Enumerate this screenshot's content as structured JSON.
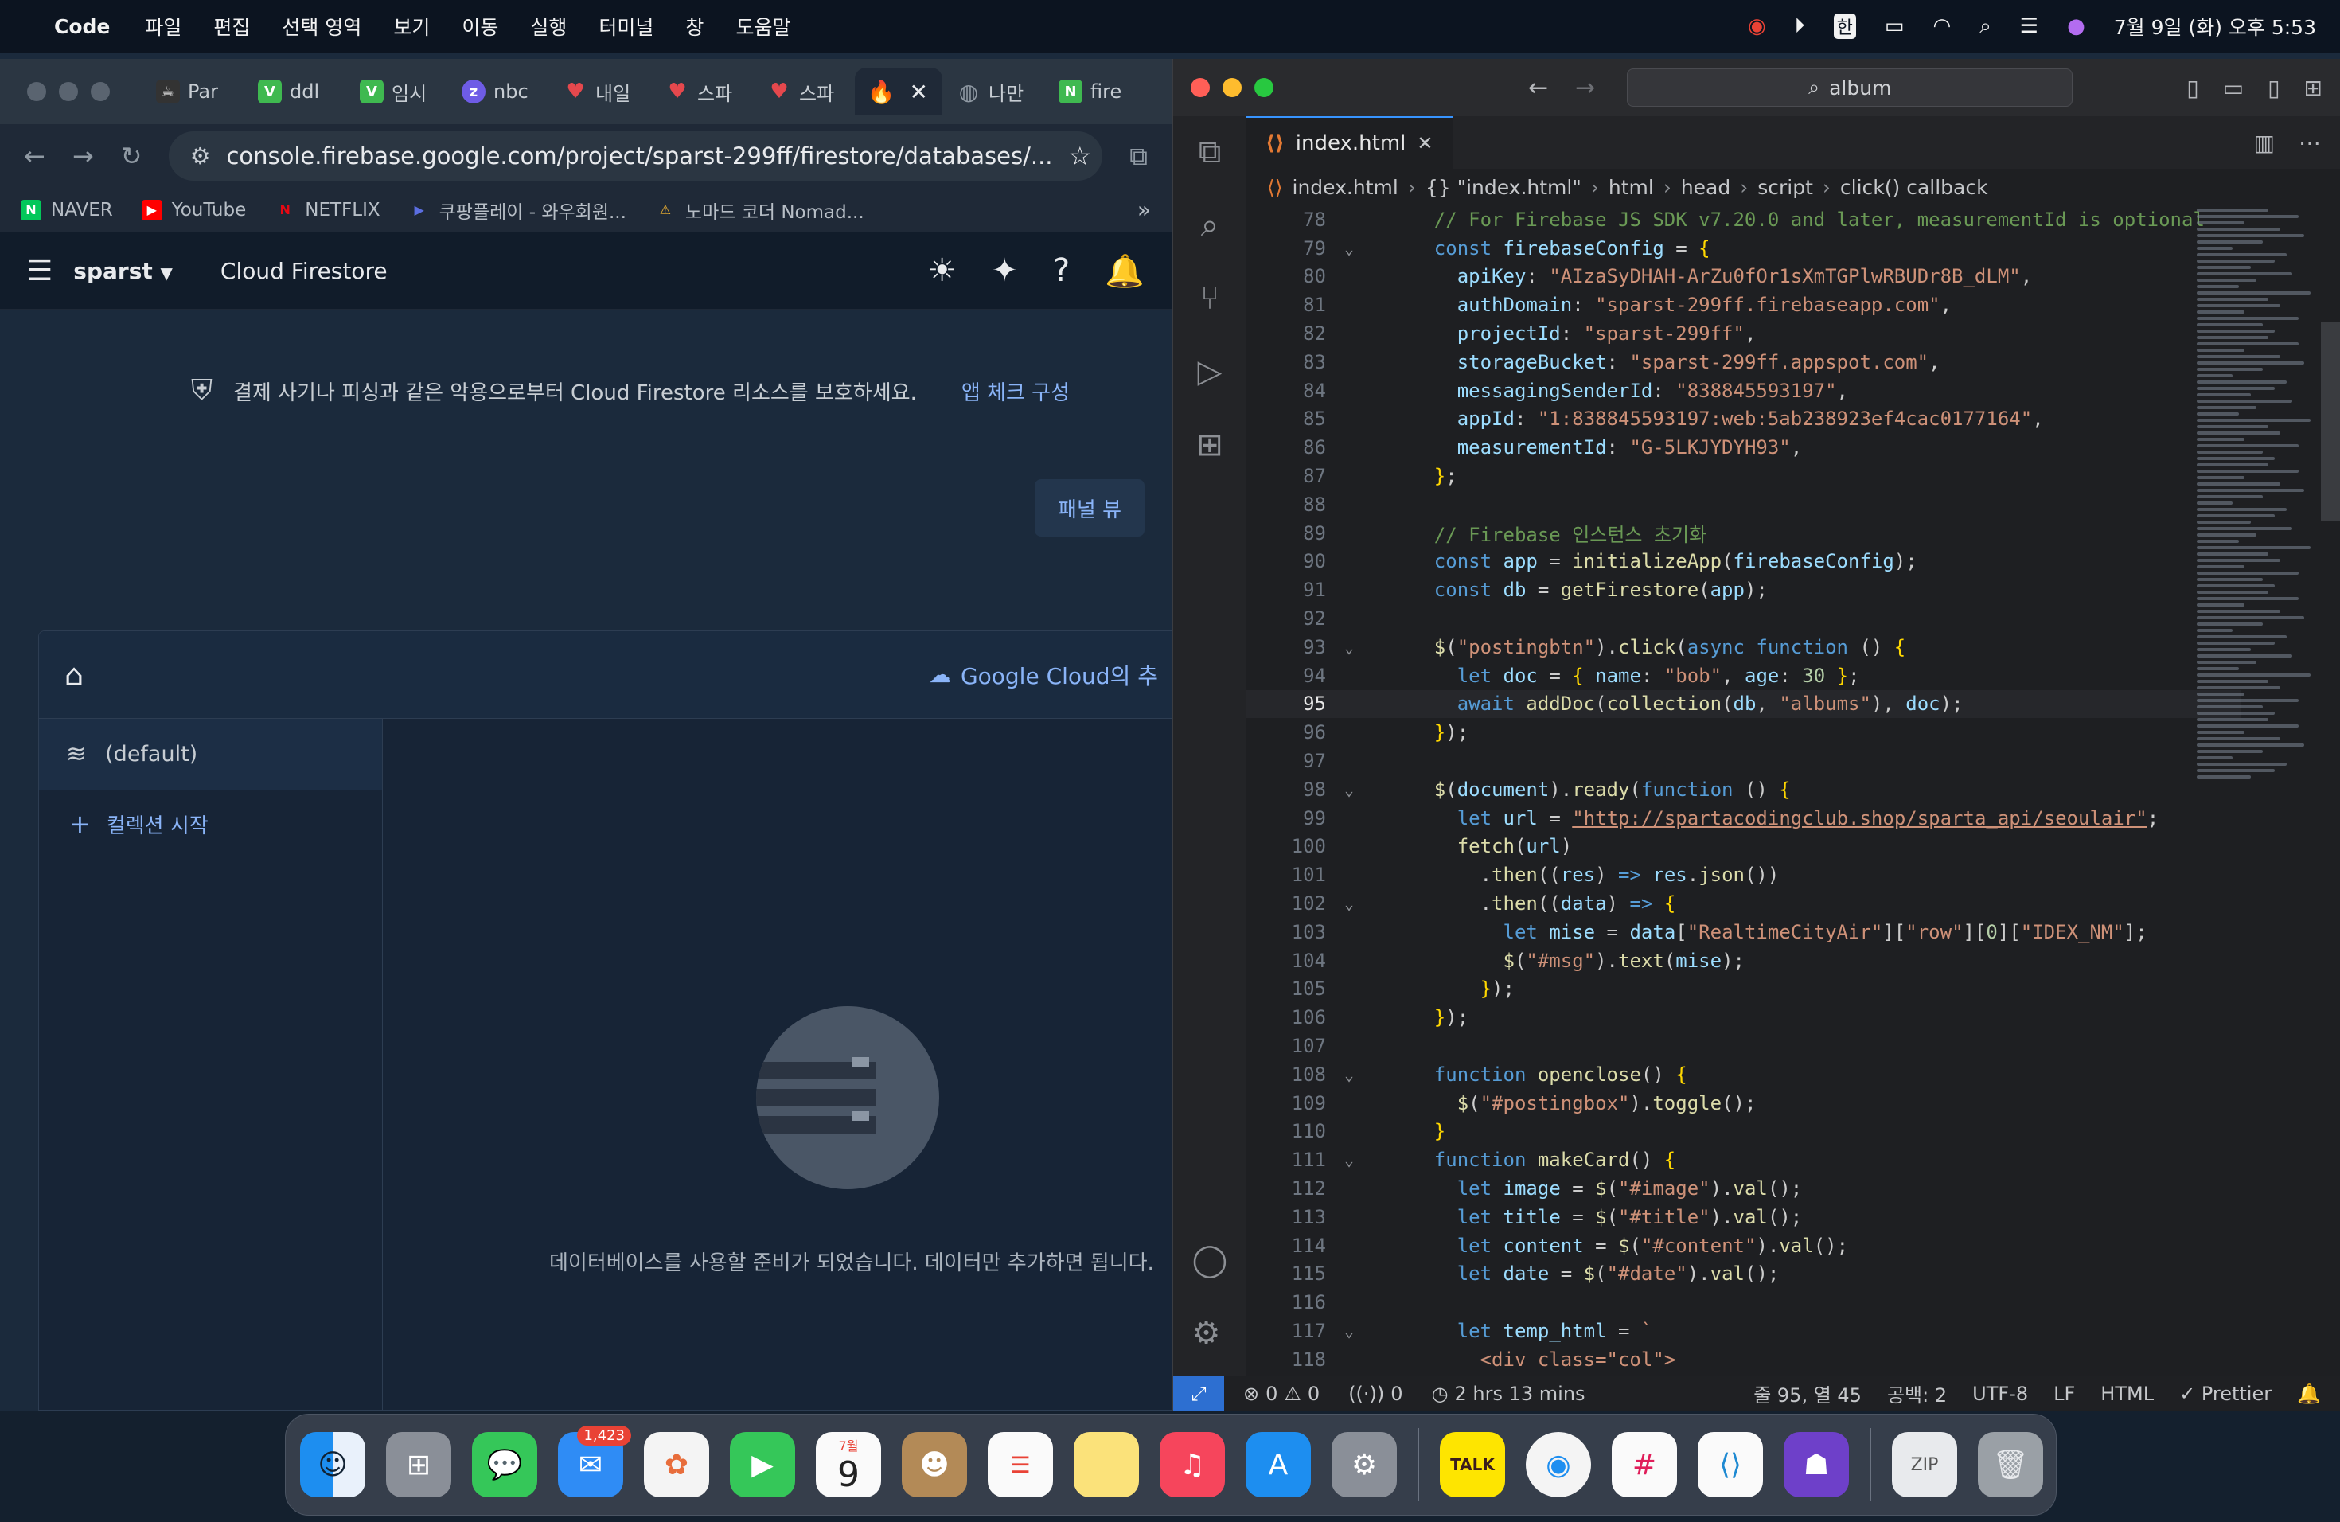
{
  "menubar": {
    "app_name": "Code",
    "items": [
      "파일",
      "편집",
      "선택 영역",
      "보기",
      "이동",
      "실행",
      "터미널",
      "창",
      "도움말"
    ],
    "datetime": "7월 9일 (화) 오후 5:53",
    "icons": [
      "screen-record-icon",
      "play-icon",
      "input-han-icon",
      "battery-icon",
      "wifi-icon",
      "search-icon",
      "control-center-icon",
      "siri-icon"
    ]
  },
  "chrome": {
    "tabs": [
      {
        "label": "Par",
        "icon": "coffee-icon",
        "color": "#333333"
      },
      {
        "label": "ddl",
        "icon": "v-icon",
        "color": "#3fb950"
      },
      {
        "label": "임시",
        "icon": "v-icon",
        "color": "#3fb950"
      },
      {
        "label": "nbc",
        "icon": "z-icon",
        "color": "#6e5ce6"
      },
      {
        "label": "내일",
        "icon": "heart-icon",
        "color": "#e5484d"
      },
      {
        "label": "스파",
        "icon": "heart-icon",
        "color": "#e5484d"
      },
      {
        "label": "스파",
        "icon": "heart-icon",
        "color": "#e5484d"
      },
      {
        "label": "",
        "icon": "firebase-icon",
        "color": "#f6a11a",
        "active": true
      },
      {
        "label": "나만",
        "icon": "globe-icon",
        "color": "#8f99a3"
      },
      {
        "label": "fire",
        "icon": "n-icon",
        "color": "#3fb950"
      }
    ],
    "url": "console.firebase.google.com/project/sparst-299ff/firestore/databases/...",
    "bookmarks": [
      {
        "label": "NAVER",
        "color": "#03c75a",
        "glyph": "N"
      },
      {
        "label": "YouTube",
        "color": "#ff0000",
        "glyph": "▶"
      },
      {
        "label": "NETFLIX",
        "color": "#e50914",
        "glyph": "N"
      },
      {
        "label": "쿠팡플레이 - 와우회원...",
        "color": "#5b6ee1",
        "glyph": "▶"
      },
      {
        "label": "노마드 코더 Nomad...",
        "color": "#f7b731",
        "glyph": "⚠"
      }
    ]
  },
  "firebase": {
    "project": "sparst",
    "service": "Cloud Firestore",
    "banner_text": "결제 사기나 피싱과 같은 악용으로부터 Cloud Firestore 리소스를 보호하세요.",
    "banner_link": "앱 체크 구성",
    "panel_view": "패널 뷰",
    "google_cloud_link": "Google Cloud의 추",
    "database": "(default)",
    "start_collection": "컬렉션 시작",
    "empty_message": "데이터베이스를 사용할 준비가 되었습니다. 데이터만 추가하면 됩니다."
  },
  "vscode": {
    "search": "album",
    "tab": "index.html",
    "breadcrumb": [
      "index.html",
      "{} \"index.html\"",
      "html",
      "head",
      "script",
      "click() callback"
    ],
    "current_line": 95,
    "lines": [
      {
        "n": 78,
        "fold": "",
        "html": "    <span class='tok-c'>// For Firebase JS SDK v7.20.0 and later, measurementId is optional</span>"
      },
      {
        "n": 79,
        "fold": "⌄",
        "html": "    <span class='tok-k'>const</span> <span class='tok-v'>firebaseConfig</span> = <span class='tok-p'>{</span>"
      },
      {
        "n": 80,
        "fold": "",
        "html": "      <span class='tok-v'>apiKey</span>: <span class='tok-s'>\"AIzaSyDHAH-ArZu0fOr1sXmTGPlwRBUDr8B_dLM\"</span>,"
      },
      {
        "n": 81,
        "fold": "",
        "html": "      <span class='tok-v'>authDomain</span>: <span class='tok-s'>\"sparst-299ff.firebaseapp.com\"</span>,"
      },
      {
        "n": 82,
        "fold": "",
        "html": "      <span class='tok-v'>projectId</span>: <span class='tok-s'>\"sparst-299ff\"</span>,"
      },
      {
        "n": 83,
        "fold": "",
        "html": "      <span class='tok-v'>storageBucket</span>: <span class='tok-s'>\"sparst-299ff.appspot.com\"</span>,"
      },
      {
        "n": 84,
        "fold": "",
        "html": "      <span class='tok-v'>messagingSenderId</span>: <span class='tok-s'>\"838845593197\"</span>,"
      },
      {
        "n": 85,
        "fold": "",
        "html": "      <span class='tok-v'>appId</span>: <span class='tok-s'>\"1:838845593197:web:5ab238923ef4cac0177164\"</span>,"
      },
      {
        "n": 86,
        "fold": "",
        "html": "      <span class='tok-v'>measurementId</span>: <span class='tok-s'>\"G-5LKJYDYH93\"</span>,"
      },
      {
        "n": 87,
        "fold": "",
        "html": "    <span class='tok-p'>}</span>;"
      },
      {
        "n": 88,
        "fold": "",
        "html": ""
      },
      {
        "n": 89,
        "fold": "",
        "html": "    <span class='tok-c'>// Firebase 인스턴스 초기화</span>"
      },
      {
        "n": 90,
        "fold": "",
        "html": "    <span class='tok-k'>const</span> <span class='tok-v'>app</span> = <span class='tok-f'>initializeApp</span>(<span class='tok-v'>firebaseConfig</span>);"
      },
      {
        "n": 91,
        "fold": "",
        "html": "    <span class='tok-k'>const</span> <span class='tok-v'>db</span> = <span class='tok-f'>getFirestore</span>(<span class='tok-v'>app</span>);"
      },
      {
        "n": 92,
        "fold": "",
        "html": ""
      },
      {
        "n": 93,
        "fold": "⌄",
        "html": "    <span class='tok-f'>$</span>(<span class='tok-s'>\"postingbtn\"</span>).<span class='tok-f'>click</span>(<span class='tok-k'>async</span> <span class='tok-k'>function</span> () <span class='tok-p'>{</span>"
      },
      {
        "n": 94,
        "fold": "",
        "html": "      <span class='tok-k'>let</span> <span class='tok-v'>doc</span> = <span class='tok-p'>{</span> <span class='tok-v'>name</span>: <span class='tok-s'>\"bob\"</span>, <span class='tok-v'>age</span>: <span class='tok-n'>30</span> <span class='tok-p'>}</span>;"
      },
      {
        "n": 95,
        "fold": "",
        "html": "      <span class='tok-k'>await</span> <span class='tok-f'>addDoc</span>(<span class='tok-f'>collection</span>(<span class='tok-v'>db</span>, <span class='tok-s'>\"albums\"</span>), <span class='tok-v'>doc</span>);"
      },
      {
        "n": 96,
        "fold": "",
        "html": "    <span class='tok-p'>}</span>);"
      },
      {
        "n": 97,
        "fold": "",
        "html": ""
      },
      {
        "n": 98,
        "fold": "⌄",
        "html": "    <span class='tok-f'>$</span>(<span class='tok-v'>document</span>).<span class='tok-f'>ready</span>(<span class='tok-k'>function</span> () <span class='tok-p'>{</span>"
      },
      {
        "n": 99,
        "fold": "",
        "html": "      <span class='tok-k'>let</span> <span class='tok-v'>url</span> = <span class='tok-u'>\"http://spartacodingclub.shop/sparta_api/seoulair\"</span>;"
      },
      {
        "n": 100,
        "fold": "",
        "html": "      <span class='tok-f'>fetch</span>(<span class='tok-v'>url</span>)"
      },
      {
        "n": 101,
        "fold": "",
        "html": "        .<span class='tok-f'>then</span>((<span class='tok-v'>res</span>) <span class='tok-k'>=&gt;</span> <span class='tok-v'>res</span>.<span class='tok-f'>json</span>())"
      },
      {
        "n": 102,
        "fold": "⌄",
        "html": "        .<span class='tok-f'>then</span>((<span class='tok-v'>data</span>) <span class='tok-k'>=&gt;</span> <span class='tok-p'>{</span>"
      },
      {
        "n": 103,
        "fold": "",
        "html": "          <span class='tok-k'>let</span> <span class='tok-v'>mise</span> = <span class='tok-v'>data</span>[<span class='tok-s'>\"RealtimeCityAir\"</span>][<span class='tok-s'>\"row\"</span>][<span class='tok-n'>0</span>][<span class='tok-s'>\"IDEX_NM\"</span>];"
      },
      {
        "n": 104,
        "fold": "",
        "html": "          <span class='tok-f'>$</span>(<span class='tok-s'>\"#msg\"</span>).<span class='tok-f'>text</span>(<span class='tok-v'>mise</span>);"
      },
      {
        "n": 105,
        "fold": "",
        "html": "        <span class='tok-p'>}</span>);"
      },
      {
        "n": 106,
        "fold": "",
        "html": "    <span class='tok-p'>}</span>);"
      },
      {
        "n": 107,
        "fold": "",
        "html": ""
      },
      {
        "n": 108,
        "fold": "⌄",
        "html": "    <span class='tok-k'>function</span> <span class='tok-f'>openclose</span>() <span class='tok-p'>{</span>"
      },
      {
        "n": 109,
        "fold": "",
        "html": "      <span class='tok-f'>$</span>(<span class='tok-s'>\"#postingbox\"</span>).<span class='tok-f'>toggle</span>();"
      },
      {
        "n": 110,
        "fold": "",
        "html": "    <span class='tok-p'>}</span>"
      },
      {
        "n": 111,
        "fold": "⌄",
        "html": "    <span class='tok-k'>function</span> <span class='tok-f'>makeCard</span>() <span class='tok-p'>{</span>"
      },
      {
        "n": 112,
        "fold": "",
        "html": "      <span class='tok-k'>let</span> <span class='tok-v'>image</span> = <span class='tok-f'>$</span>(<span class='tok-s'>\"#image\"</span>).<span class='tok-f'>val</span>();"
      },
      {
        "n": 113,
        "fold": "",
        "html": "      <span class='tok-k'>let</span> <span class='tok-v'>title</span> = <span class='tok-f'>$</span>(<span class='tok-s'>\"#title\"</span>).<span class='tok-f'>val</span>();"
      },
      {
        "n": 114,
        "fold": "",
        "html": "      <span class='tok-k'>let</span> <span class='tok-v'>content</span> = <span class='tok-f'>$</span>(<span class='tok-s'>\"#content\"</span>).<span class='tok-f'>val</span>();"
      },
      {
        "n": 115,
        "fold": "",
        "html": "      <span class='tok-k'>let</span> <span class='tok-v'>date</span> = <span class='tok-f'>$</span>(<span class='tok-s'>\"#date\"</span>).<span class='tok-f'>val</span>();"
      },
      {
        "n": 116,
        "fold": "",
        "html": ""
      },
      {
        "n": 117,
        "fold": "⌄",
        "html": "      <span class='tok-k'>let</span> <span class='tok-v'>temp_html</span> = <span class='tok-s'>`</span>"
      },
      {
        "n": 118,
        "fold": "",
        "html": "        <span class='tok-s'>&lt;div class=\"col\"&gt;</span>"
      }
    ],
    "status": {
      "errors": "0",
      "warnings": "0",
      "ports": "0",
      "time": "2 hrs 13 mins",
      "position": "줄 95, 열 45",
      "spaces": "공백: 2",
      "encoding": "UTF-8",
      "eol": "LF",
      "language": "HTML",
      "formatter": "Prettier"
    }
  },
  "dock": {
    "mail_badge": "1,423",
    "calendar_month": "7월",
    "calendar_day": "9",
    "kakaotalk_label": "TALK",
    "apps": [
      "finder-icon",
      "launchpad-icon",
      "messages-icon",
      "mail-icon",
      "photos-icon",
      "facetime-icon",
      "calendar-icon",
      "contacts-icon",
      "reminders-icon",
      "notes-icon",
      "music-icon",
      "appstore-icon",
      "settings-icon",
      "kakaotalk-icon",
      "chrome-icon",
      "slack-icon",
      "vscode-icon",
      "github-desktop-icon",
      "archive-icon",
      "trash-icon"
    ]
  }
}
